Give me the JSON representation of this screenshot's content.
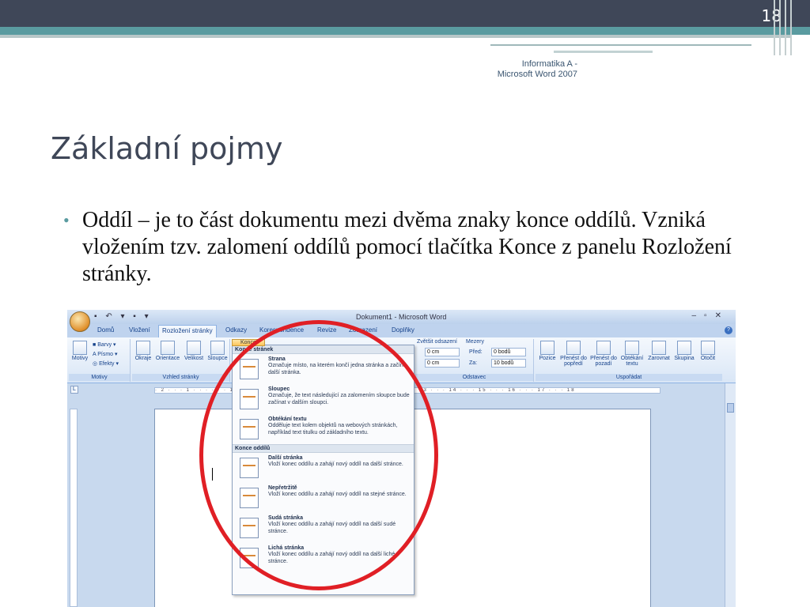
{
  "slide": {
    "number": "18",
    "footer_line1": "Informatika A -",
    "footer_line2": "Microsoft Word 2007",
    "title": "Základní pojmy",
    "bullet_text": "Oddíl – je to část dokumentu mezi dvěma znaky konce oddílů. Vzniká vložením tzv. zalomení oddílů pomocí tlačítka Konce z panelu Rozložení stránky."
  },
  "word": {
    "window_title": "Dokument1 - Microsoft Word",
    "tabs": [
      "Domů",
      "Vložení",
      "Rozložení stránky",
      "Odkazy",
      "Korespondence",
      "Revize",
      "Zobrazení",
      "Doplňky"
    ],
    "active_tab": "Rozložení stránky",
    "ribbon": {
      "motivy": {
        "label": "Motivy",
        "btn": "Motivy",
        "barvy": "Barvy",
        "pismo": "Písmo",
        "efekty": "Efekty"
      },
      "vzhled": {
        "label": "Vzhled stránky",
        "okraje": "Okraje",
        "orientace": "Orientace",
        "velikost": "Velikost",
        "sloupce": "Sloupce"
      },
      "konce_label": "Konce",
      "odstavec": {
        "label": "Odstavec",
        "zvetsit": "Zvětšit odsazení",
        "mezery": "Mezery",
        "vlevo_val": "0 cm",
        "vpravo_val": "0 cm",
        "pred_label": "Před:",
        "pred_val": "0 bodů",
        "za_label": "Za:",
        "za_val": "10 bodů"
      },
      "usporadat": {
        "label": "Uspořádat",
        "pozice": "Pozice",
        "prenest_dopredu": "Přenést do popředí",
        "prenest_dozadu": "Přenést do pozadí",
        "obtekani": "Obtékání textu",
        "zarovnat": "Zarovnat",
        "skupina": "Skupina",
        "otocit": "Otočit"
      }
    },
    "ruler_text": "· 2 · · · 1 · · · · · · 1 · · · 2 · · · 3 · · · 9 · · · 10 · · · 11 · · · 12 · · · 13 · · · 14 · · · 15 · · · 16 · · · 17 · · · 18",
    "menu": {
      "section1": "Konce stránek",
      "items1": [
        {
          "title": "Strana",
          "desc": "Označuje místo, na kterém končí jedna stránka a začíná další stránka."
        },
        {
          "title": "Sloupec",
          "desc": "Označuje, že text následující za zalomením sloupce bude začínat v dalším sloupci."
        },
        {
          "title": "Obtékání textu",
          "desc": "Odděluje text kolem objektů na webových stránkách, například text titulku od základního textu."
        }
      ],
      "section2": "Konce oddílů",
      "items2": [
        {
          "title": "Další stránka",
          "desc": "Vloží konec oddílu a zahájí nový oddíl na další stránce."
        },
        {
          "title": "Nepřetržitě",
          "desc": "Vloží konec oddílu a zahájí nový oddíl na stejné stránce."
        },
        {
          "title": "Sudá stránka",
          "desc": "Vloží konec oddílu a zahájí nový oddíl na další sudé stránce."
        },
        {
          "title": "Lichá stránka",
          "desc": "Vloží konec oddílu a zahájí nový oddíl na další liché stránce."
        }
      ]
    }
  },
  "colors": {
    "accent": "#5a9ba0",
    "topbar": "#3f4758",
    "annotation": "#e01f25"
  }
}
